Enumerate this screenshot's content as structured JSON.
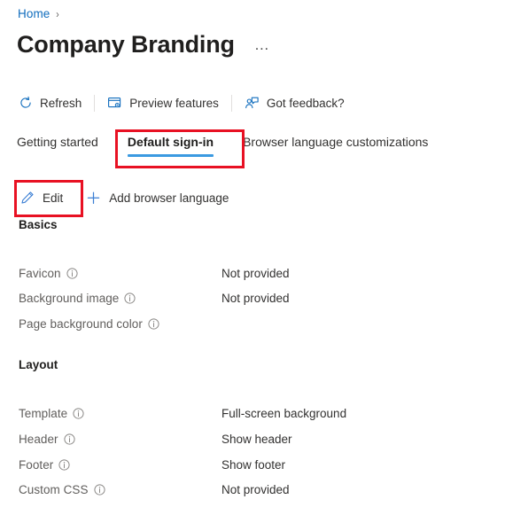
{
  "breadcrumb": {
    "home_label": "Home",
    "separator": "›"
  },
  "header": {
    "title": "Company Branding",
    "ellipsis": "…",
    "ellipsis_name": "more-options"
  },
  "command_bar": {
    "items": [
      {
        "label": "Refresh",
        "icon": "refresh-icon"
      },
      {
        "label": "Preview features",
        "icon": "preview-features-icon"
      },
      {
        "label": "Got feedback?",
        "icon": "feedback-icon"
      }
    ]
  },
  "tabs": [
    {
      "label": "Getting started",
      "selected": false
    },
    {
      "label": "Default sign-in",
      "selected": true
    },
    {
      "label": "Browser language customizations",
      "selected": false
    }
  ],
  "action_bar": {
    "edit_label": "Edit",
    "edit_icon": "pencil-icon",
    "add_language_label": "Add browser language",
    "add_language_icon": "plus-icon"
  },
  "sections": [
    {
      "heading": "Basics",
      "rows": [
        {
          "label": "Favicon",
          "value": "Not provided",
          "info": true
        },
        {
          "label": "Background image",
          "value": "Not provided",
          "info": true
        },
        {
          "label": "Page background color",
          "value": "",
          "info": true
        }
      ]
    },
    {
      "heading": "Layout",
      "rows": [
        {
          "label": "Template",
          "value": "Full-screen background",
          "info": true
        },
        {
          "label": "Header",
          "value": "Show header",
          "info": true
        },
        {
          "label": "Footer",
          "value": "Show footer",
          "info": true
        },
        {
          "label": "Custom CSS",
          "value": "Not provided",
          "info": true
        }
      ]
    }
  ],
  "annotations": [
    {
      "target": "Default sign-in tab",
      "color": "#e81123"
    },
    {
      "target": "Edit button",
      "color": "#e81123"
    }
  ],
  "colors": {
    "link": "#0f6cbd",
    "accent_underline": "#3b9ae1",
    "icon_blue": "#0f6cbd",
    "annotation_red": "#e81123",
    "label_gray": "#605e5c",
    "text_dark": "#201f1e"
  }
}
